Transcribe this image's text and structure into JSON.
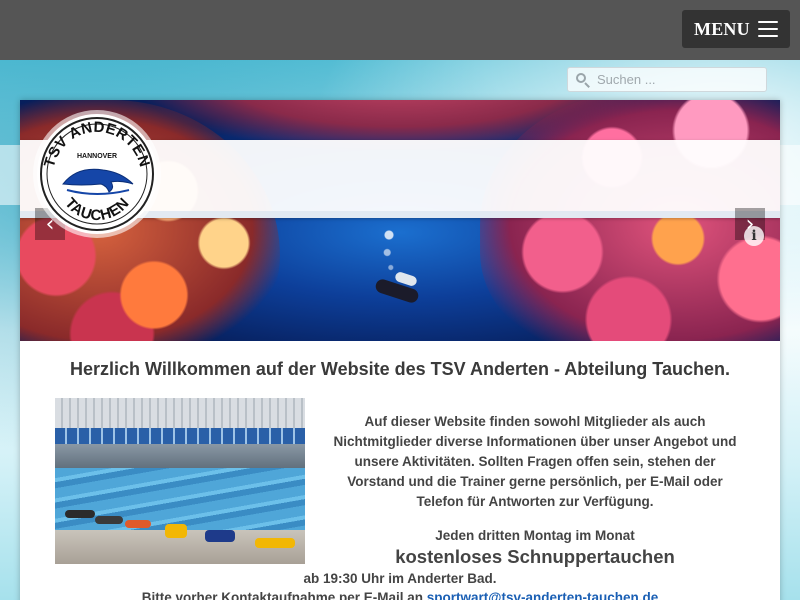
{
  "header": {
    "menu_label": "MENU",
    "menu_icon": "hamburger-icon"
  },
  "search": {
    "placeholder": "Suchen ...",
    "value": "",
    "icon": "search-icon"
  },
  "slider": {
    "prev_icon": "chevron-left-icon",
    "next_icon": "chevron-right-icon",
    "info_icon": "info-icon",
    "prev_glyph": "‹",
    "next_glyph": "›",
    "info_glyph": "i"
  },
  "logo": {
    "text_top": "TSV ANDERTEN",
    "text_middle": "HANNOVER",
    "text_bottom": "TAUCHEN"
  },
  "main": {
    "welcome_title": "Herzlich Willkommen auf der Website des TSV Anderten - Abteilung Tauchen.",
    "intro": "Auf dieser Website finden sowohl Mitglieder als auch Nichtmitglieder diverse Informationen über unser Angebot und unsere Aktivitäten. Sollten Fragen offen sein, stehen der Vorstand und die Trainer gerne persönlich, per E-Mail oder Telefon für Antworten zur Verfügung.",
    "monday_line": "Jeden dritten Montag im Monat",
    "trial_dive": "kostenloses Schnuppertauchen",
    "time_line": "ab 19:30 Uhr im Anderter Bad.",
    "contact_prefix": "Bitte vorher Kontaktaufnahme per E-Mail an ",
    "contact_email": "sportwart@tsv-anderten-tauchen.de"
  },
  "colors": {
    "topbar": "#555555",
    "menu_button": "#333333",
    "link": "#1a5fb4",
    "text": "#444444",
    "logo_blue": "#1546a8"
  }
}
